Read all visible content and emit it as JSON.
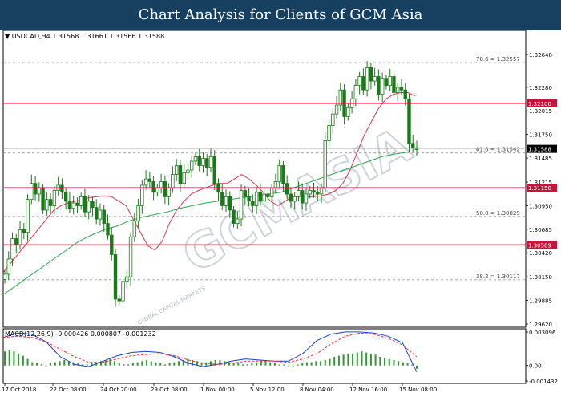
{
  "header": {
    "title": "Chart Analysis for Clients of GCM Asia"
  },
  "symbol_bar": {
    "text": "USDCAD,H4  1.31568 1.31661 1.31566 1.31588"
  },
  "macd_bar": {
    "text": "MACD(12,26,9) -0.000426 0.000807 -0.001232"
  },
  "colors": {
    "header_bg": "#173f5f",
    "resistance_line": "#c8133a",
    "candle": "#1a7a1a",
    "ma_red": "#e0334d",
    "ma_green": "#2ea84f",
    "macd_signal": "#ff2a2a",
    "macd_main": "#1b3fd9",
    "hist": "#2d9a2d",
    "watermark": "#9aa8b8"
  },
  "watermark": {
    "main": "GCMASIA",
    "sub": "GLOBAL CAPITAL MARKETS"
  },
  "chart_data": {
    "type": "candlestick",
    "symbol": "USDCAD",
    "timeframe": "H4",
    "ylim": [
      1.2962,
      1.32648
    ],
    "price_ticks": [
      "1.32648",
      "1.32280",
      "1.32015",
      "1.31750",
      "1.31485",
      "1.31215",
      "1.30950",
      "1.30685",
      "1.30420",
      "1.30150",
      "1.29885",
      "1.29620"
    ],
    "x_ticks": [
      "17 Oct 2018",
      "22 Oct 08:00",
      "24 Oct 20:00",
      "29 Oct 08:00",
      "1 Nov 00:00",
      "5 Nov 12:00",
      "8 Nov 04:00",
      "12 Nov 16:00",
      "15 Nov 08:00"
    ],
    "fib_levels": [
      {
        "label": "78.6 = 1.32557",
        "value": 1.32557
      },
      {
        "label": "61.8 = 1.31542",
        "value": 1.31542
      },
      {
        "label": "50.0 = 1.30829",
        "value": 1.30829
      },
      {
        "label": "38.2 = 1.30117",
        "value": 1.30117
      }
    ],
    "horizontal_levels": [
      {
        "label": "1.32100",
        "value": 1.321
      },
      {
        "label": "1.31150",
        "value": 1.3115
      },
      {
        "label": "1.30509",
        "value": 1.30509
      }
    ],
    "current_price": {
      "label": "1.31588",
      "value": 1.31588
    },
    "close_series": [
      1.3018,
      1.3035,
      1.3058,
      1.3051,
      1.3068,
      1.3065,
      1.3102,
      1.312,
      1.3108,
      1.3115,
      1.309,
      1.3102,
      1.3095,
      1.3112,
      1.3118,
      1.311,
      1.31,
      1.3092,
      1.3098,
      1.3095,
      1.3105,
      1.3088,
      1.31,
      1.3093,
      1.308,
      1.309,
      1.3075,
      1.3062,
      1.304,
      1.299,
      1.2988,
      1.301,
      1.3015,
      1.306,
      1.3078,
      1.3095,
      1.3118,
      1.3125,
      1.3122,
      1.311,
      1.3115,
      1.3122,
      1.3105,
      1.3115,
      1.313,
      1.314,
      1.312,
      1.3132,
      1.3135,
      1.3145,
      1.315,
      1.314,
      1.3148,
      1.3138,
      1.315,
      1.312,
      1.311,
      1.3095,
      1.3105,
      1.309,
      1.3075,
      1.308,
      1.3112,
      1.3105,
      1.31,
      1.3095,
      1.311,
      1.31,
      1.3108,
      1.3105,
      1.3115,
      1.3122,
      1.314,
      1.312,
      1.3108,
      1.31,
      1.3105,
      1.3112,
      1.3098,
      1.3108,
      1.3112,
      1.311,
      1.3108,
      1.3115,
      1.3168,
      1.3185,
      1.3198,
      1.3208,
      1.3225,
      1.3195,
      1.3205,
      1.3215,
      1.323,
      1.324,
      1.3225,
      1.325,
      1.3235,
      1.324,
      1.322,
      1.3238,
      1.323,
      1.324,
      1.3222,
      1.3228,
      1.3225,
      1.3215,
      1.3165,
      1.316,
      1.3158
    ],
    "ma_red": [
      1.302,
      1.303,
      1.304,
      1.305,
      1.306,
      1.307,
      1.308,
      1.309,
      1.3095,
      1.3098,
      1.31,
      1.3102,
      1.3104,
      1.3105,
      1.3106,
      1.3105,
      1.31,
      1.3095,
      1.308,
      1.3065,
      1.305,
      1.3045,
      1.3055,
      1.3075,
      1.309,
      1.31,
      1.3108,
      1.3112,
      1.3115,
      1.3118,
      1.312,
      1.312,
      1.3125,
      1.313,
      1.3125,
      1.3118,
      1.311,
      1.31,
      1.3095,
      1.31,
      1.3105,
      1.3106,
      1.3105,
      1.3105,
      1.3106,
      1.3108,
      1.3112,
      1.312,
      1.3135,
      1.3155,
      1.3175,
      1.319,
      1.3205,
      1.3215,
      1.322,
      1.3222,
      1.3222,
      1.3218
    ],
    "ma_green": [
      1.2995,
      1.3005,
      1.3015,
      1.3025,
      1.3035,
      1.3045,
      1.3055,
      1.3062,
      1.3068,
      1.3072,
      1.3078,
      1.3082,
      1.3085,
      1.3088,
      1.3092,
      1.3095,
      1.3098,
      1.31,
      1.3102,
      1.3104,
      1.3106,
      1.3108,
      1.311,
      1.3115,
      1.312,
      1.3125,
      1.313,
      1.3135,
      1.314,
      1.3145,
      1.315,
      1.3153,
      1.3155
    ],
    "macd_axis": {
      "ticks": [
        "0.003096",
        "0.00",
        "-0.001432"
      ],
      "ylim": [
        -0.001432,
        0.003096
      ]
    },
    "macd_signal": [
      0.0026,
      0.0027,
      0.0026,
      0.0022,
      0.0015,
      0.0008,
      0.0003,
      0.0003,
      0.0006,
      0.0009,
      0.001,
      0.0011,
      0.0009,
      0.0005,
      0.0002,
      0.0001,
      0.0002,
      0.0004,
      0.0004,
      0.0004,
      0.0003,
      0.0006,
      0.0011,
      0.002,
      0.0027,
      0.003,
      0.0029,
      0.0025,
      0.0019,
      0.0008
    ],
    "macd_main": [
      0.0026,
      0.003,
      0.0029,
      0.0022,
      0.0008,
      0.0001,
      -0.0001,
      0.0004,
      0.0009,
      0.0012,
      0.0013,
      0.0012,
      0.0008,
      0.0002,
      -0.0001,
      0.0001,
      0.0004,
      0.0006,
      0.0005,
      0.0004,
      0.0004,
      0.0011,
      0.0023,
      0.0029,
      0.0031,
      0.0031,
      0.003,
      0.0027,
      0.0021,
      -0.0006
    ],
    "macd_hist": [
      0.0013,
      0.0014,
      0.0013,
      0.0011,
      0.0009,
      0.0006,
      0.0003,
      0.0002,
      0.0001,
      0.0,
      0.0002,
      0.0003,
      0.0004,
      0.0005,
      0.0004,
      0.0003,
      0.0002,
      0.0001,
      0.0001,
      0.0002,
      0.0003,
      0.0004,
      0.0005,
      0.0006,
      0.0004,
      0.0002,
      0.0001,
      0.0001,
      0.0002,
      0.0003,
      0.0004,
      0.0005,
      0.0004,
      0.0003,
      0.0002,
      0.0001,
      0.0002,
      0.0003,
      0.0004,
      0.0005,
      0.0006,
      0.0005,
      0.0004,
      0.0003,
      0.0003,
      0.0004,
      0.0005,
      0.0005,
      0.0004,
      0.0003,
      0.0002,
      0.0002,
      0.0001,
      0.0001,
      0.0002,
      0.0003,
      0.0004,
      0.0004,
      0.0003,
      0.0002,
      0.0001,
      0.0001,
      0.0,
      0.0,
      0.0001,
      0.0002,
      0.0003,
      0.0003,
      0.0004,
      0.0004,
      0.0005,
      0.0006,
      0.0008,
      0.0009,
      0.001,
      0.0011,
      0.0011,
      0.0012,
      0.0013,
      0.0012,
      0.0011,
      0.001,
      0.0008,
      0.0007,
      0.0006,
      0.0005,
      0.0004,
      0.0003,
      0.0002,
      0.0001,
      -0.0003
    ]
  }
}
